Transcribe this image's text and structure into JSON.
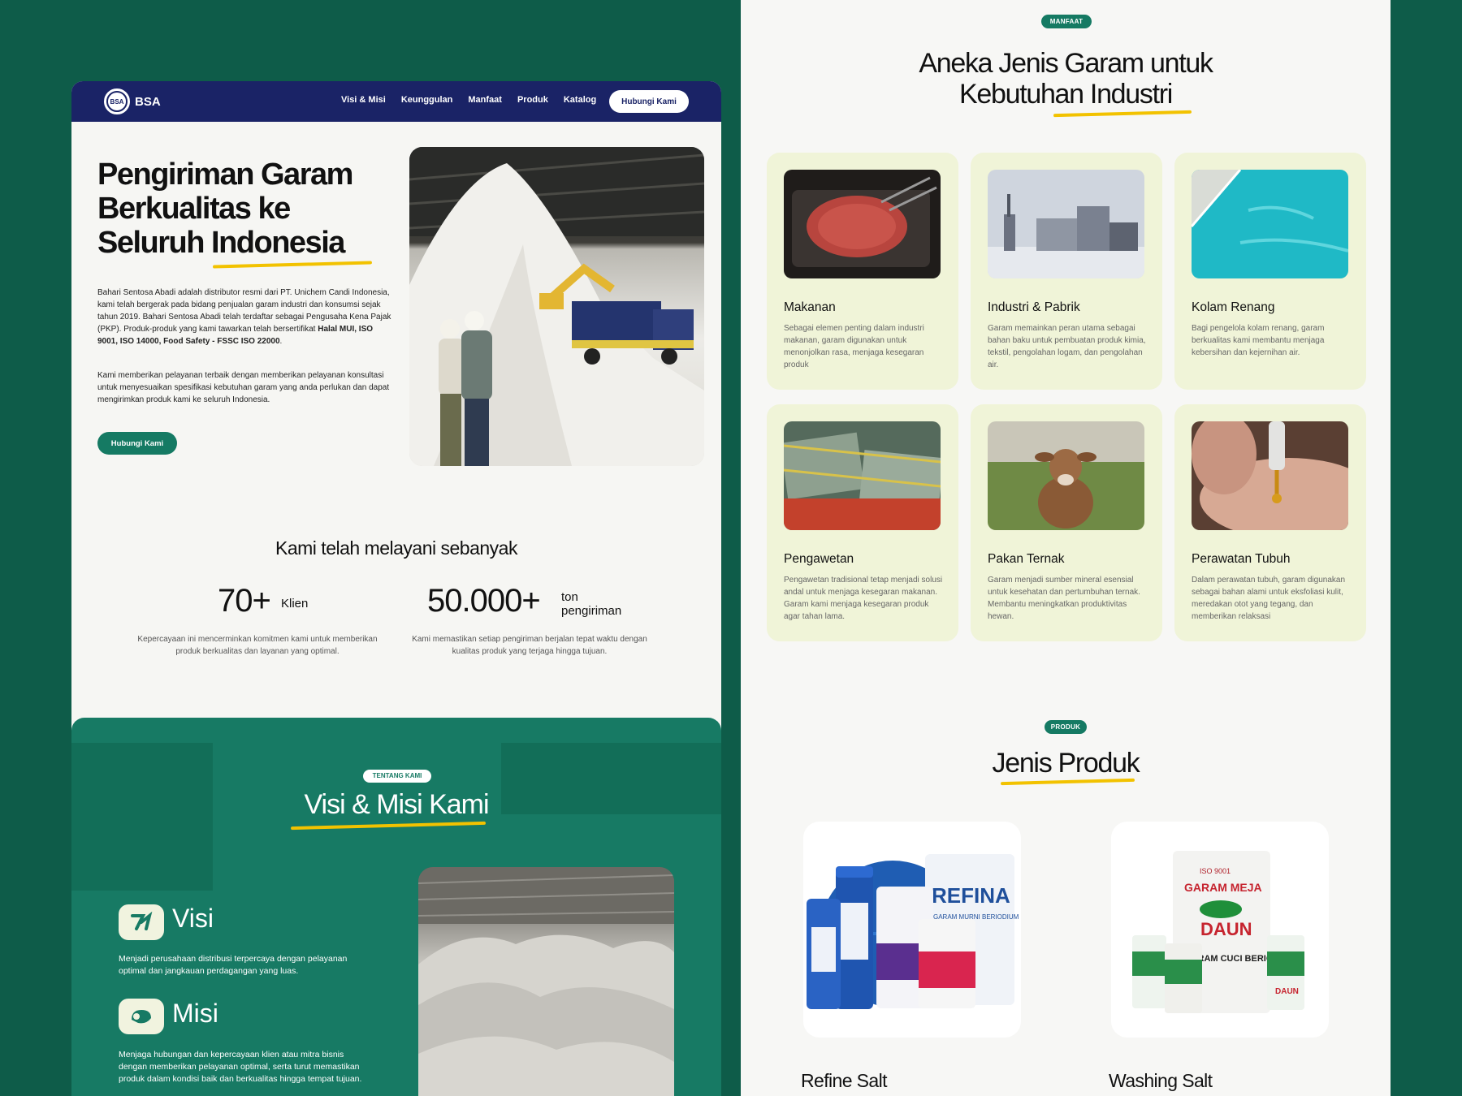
{
  "nav": {
    "logo_text": "BSA",
    "logo_mark": "BSA",
    "menu": [
      "Visi & Misi",
      "Keunggulan",
      "Manfaat",
      "Produk",
      "Katalog"
    ],
    "cta": "Hubungi Kami"
  },
  "hero": {
    "title": "Pengiriman Garam Berkualitas ke Seluruh Indonesia",
    "p1_main": "Bahari Sentosa Abadi adalah distributor resmi dari PT. Unichem Candi Indonesia, kami telah bergerak pada bidang penjualan garam industri dan konsumsi sejak tahun 2019. Bahari Sentosa Abadi telah terdaftar sebagai Pengusaha Kena Pajak (PKP). Produk-produk yang kami tawarkan telah bersertifikat ",
    "p1_bold": "Halal MUI, ISO 9001, ISO 14000, Food Safety - FSSC ISO 22000",
    "p1_end": ".",
    "p2": "Kami memberikan pelayanan terbaik dengan memberikan pelayanan konsultasi untuk menyesuaikan spesifikasi kebutuhan garam yang anda perlukan dan dapat mengirimkan produk kami ke seluruh Indonesia.",
    "button": "Hubungi Kami"
  },
  "stats": {
    "heading": "Kami telah melayani sebanyak",
    "items": [
      {
        "number": "70+",
        "unit": "Klien",
        "desc": "Kepercayaan ini mencerminkan komitmen kami untuk memberikan produk berkualitas dan layanan yang optimal."
      },
      {
        "number": "50.000+",
        "unit_line1": "ton",
        "unit_line2": "pengiriman",
        "desc": "Kami memastikan setiap pengiriman berjalan tepat waktu dengan kualitas produk yang terjaga hingga tujuan."
      }
    ]
  },
  "about": {
    "badge": "TENTANG KAMI",
    "title": "Visi & Misi Kami",
    "visi_title": "Visi",
    "visi_text": "Menjadi perusahaan distribusi terpercaya dengan pelayanan optimal dan jangkauan perdagangan yang luas.",
    "misi_title": "Misi",
    "misi_text": "Menjaga hubungan dan kepercayaan klien atau mitra bisnis dengan memberikan pelayanan optimal, serta turut memastikan produk dalam kondisi baik dan berkualitas hingga tempat tujuan."
  },
  "benefits": {
    "badge": "MANFAAT",
    "title_line1": "Aneka Jenis Garam untuk",
    "title_line2": "Kebutuhan Industri",
    "cards": [
      {
        "title": "Makanan",
        "desc": "Sebagai elemen penting dalam industri makanan, garam digunakan untuk menonjolkan rasa, menjaga kesegaran produk"
      },
      {
        "title": "Industri & Pabrik",
        "desc": "Garam memainkan peran utama sebagai bahan baku untuk pembuatan produk kimia, tekstil, pengolahan logam, dan pengolahan air."
      },
      {
        "title": "Kolam Renang",
        "desc": "Bagi pengelola kolam renang, garam berkualitas kami membantu menjaga kebersihan dan kejernihan air."
      },
      {
        "title": "Pengawetan",
        "desc": "Pengawetan tradisional tetap menjadi solusi andal untuk menjaga kesegaran makanan. Garam kami menjaga kesegaran produk agar tahan lama."
      },
      {
        "title": "Pakan Ternak",
        "desc": "Garam menjadi sumber mineral esensial untuk kesehatan dan pertumbuhan ternak. Membantu meningkatkan produktivitas hewan."
      },
      {
        "title": "Perawatan Tubuh",
        "desc": "Dalam perawatan tubuh, garam digunakan sebagai bahan alami untuk eksfoliasi kulit, meredakan otot yang tegang, dan memberikan relaksasi"
      }
    ]
  },
  "products": {
    "badge": "PRODUK",
    "title": "Jenis Produk",
    "items": [
      {
        "name": "Refine Salt",
        "pack_text": "REFINA",
        "pack_sub": "GARAM MURNI BERIODIUM"
      },
      {
        "name": "Washing Salt",
        "pack_iso": "ISO 9001",
        "pack_title": "GARAM MEJA",
        "pack_brand": "DAUN",
        "pack_sub": "GARAM CUCI BERIODIUM"
      }
    ]
  },
  "colors": {
    "bg_green": "#0e5c49",
    "primary": "#157a63",
    "navy": "#1a2366",
    "accent_yellow": "#f2c200",
    "card_bg": "#f0f4d8"
  }
}
